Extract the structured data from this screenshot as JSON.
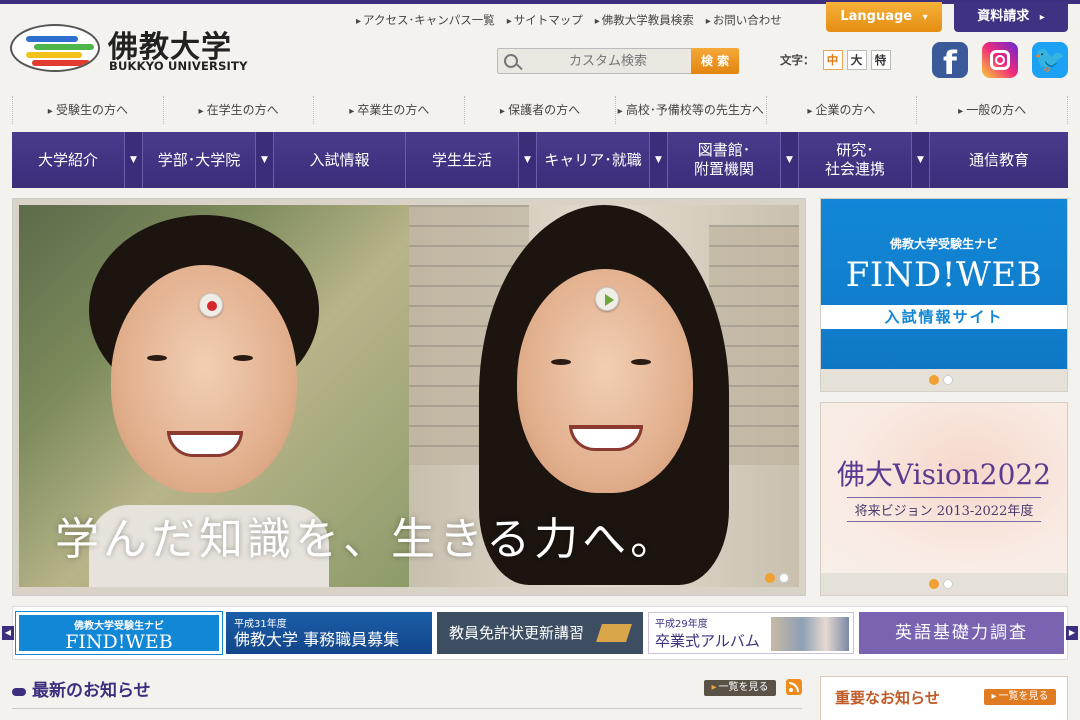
{
  "brand": {
    "name": "佛教大学",
    "name_en": "BUKKYO UNIVERSITY",
    "colors": {
      "primary": "#3d2f7e",
      "accent": "#f1a133",
      "blue": "#1287d6"
    }
  },
  "utility_links": [
    "アクセス･キャンパス一覧",
    "サイトマップ",
    "佛教大学教員検索",
    "お問い合わせ"
  ],
  "header_buttons": {
    "language": "Language",
    "language_arrow": "▾",
    "request": "資料請求",
    "request_arrow": "▸"
  },
  "search": {
    "placeholder": "カスタム検索",
    "button": "検 索",
    "icon": "search-icon"
  },
  "font_size": {
    "label": "文字：",
    "options": [
      "中",
      "大",
      "特"
    ],
    "active": "中"
  },
  "social": {
    "facebook": "f",
    "instagram": "",
    "twitter": "🐦"
  },
  "audience_nav": [
    "受験生の方へ",
    "在学生の方へ",
    "卒業生の方へ",
    "保護者の方へ",
    "高校･予備校等の先生方へ",
    "企業の方へ",
    "一般の方へ"
  ],
  "main_nav": [
    {
      "label": "大学紹介",
      "has_dropdown": true
    },
    {
      "label": "学部･大学院",
      "has_dropdown": true
    },
    {
      "label": "入試情報",
      "has_dropdown": false
    },
    {
      "label": "学生生活",
      "has_dropdown": true
    },
    {
      "label": "キャリア･就職",
      "has_dropdown": true
    },
    {
      "label": "図書館･\n附置機関",
      "has_dropdown": true
    },
    {
      "label": "研究･\n社会連携",
      "has_dropdown": true
    },
    {
      "label": "通信教育",
      "has_dropdown": false
    }
  ],
  "nav_arrow": "▼",
  "hero": {
    "caption": "学んだ知識を、生きる力へ。"
  },
  "side_banners": {
    "findweb": {
      "sub": "佛教大学受験生ナビ",
      "main": "FIND!WEB",
      "strip": "入試情報サイト"
    },
    "vision": {
      "main": "佛大Vision2022",
      "sub": "将来ビジョン 2013-2022年度"
    }
  },
  "banner_strip": {
    "prev": "◀",
    "next": "▶",
    "items": [
      {
        "sub": "佛教大学受験生ナビ",
        "main": "FIND!WEB"
      },
      {
        "sub": "平成31年度",
        "main": "佛教大学 事務職員募集"
      },
      {
        "sub": "",
        "main": "教員免許状更新講習"
      },
      {
        "sub": "平成29年度",
        "main": "卒業式アルバム"
      },
      {
        "sub": "",
        "main": "英語基礎力調査"
      }
    ]
  },
  "news": {
    "title": "最新のお知らせ",
    "more": "一覧を見る"
  },
  "important": {
    "title": "重要なお知らせ",
    "more": "一覧を見る"
  }
}
